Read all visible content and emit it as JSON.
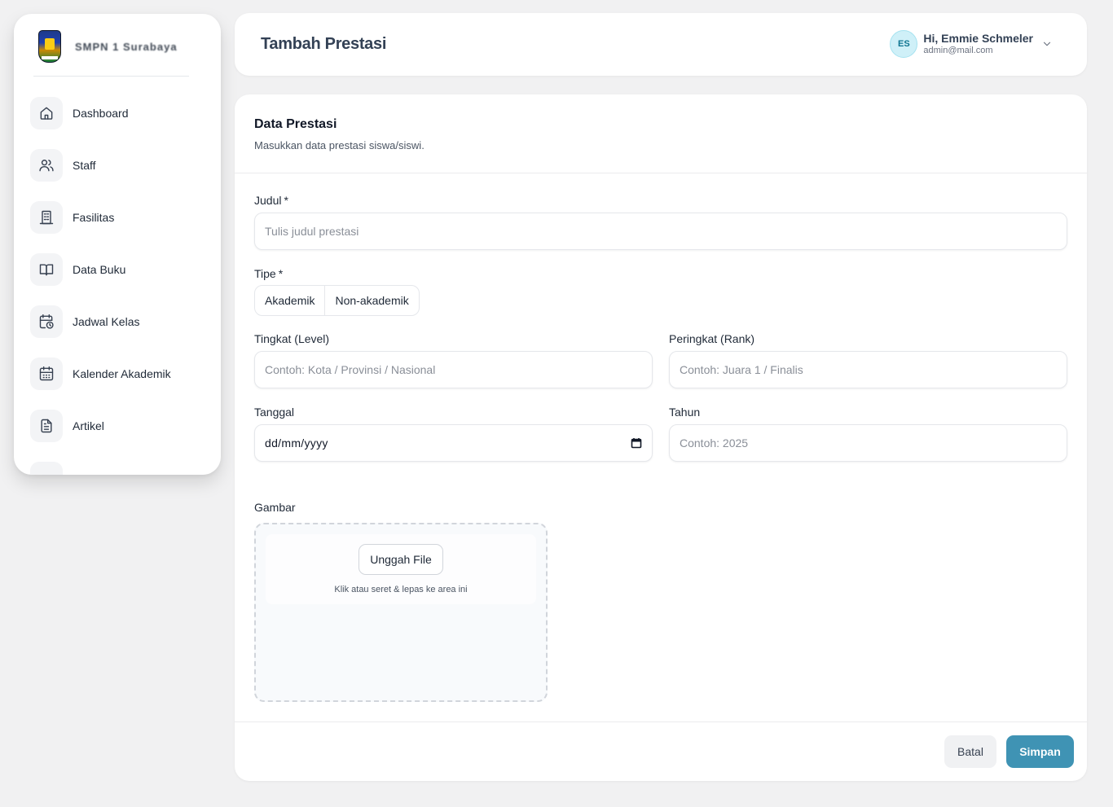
{
  "brand": {
    "name": "SMPN 1 Surabaya",
    "logo_icon": "school-emblem-icon"
  },
  "sidebar": {
    "items": [
      {
        "label": "Dashboard",
        "icon": "home-icon"
      },
      {
        "label": "Staff",
        "icon": "users-icon"
      },
      {
        "label": "Fasilitas",
        "icon": "building-icon"
      },
      {
        "label": "Data Buku",
        "icon": "book-icon"
      },
      {
        "label": "Jadwal Kelas",
        "icon": "calendar-clock-icon"
      },
      {
        "label": "Kalender Akademik",
        "icon": "calendar-icon"
      },
      {
        "label": "Artikel",
        "icon": "document-icon"
      }
    ]
  },
  "header": {
    "title": "Tambah Prestasi",
    "user": {
      "initials": "ES",
      "greeting": "Hi, Emmie Schmeler",
      "email": "admin@mail.com"
    }
  },
  "form": {
    "title": "Data Prestasi",
    "subtitle": "Masukkan data prestasi siswa/siswi.",
    "judul": {
      "label": "Judul",
      "required_mark": "*",
      "placeholder": "Tulis judul prestasi",
      "value": ""
    },
    "tipe": {
      "label": "Tipe",
      "required_mark": "*",
      "options": [
        "Akademik",
        "Non-akademik"
      ]
    },
    "tingkat": {
      "label": "Tingkat (Level)",
      "placeholder": "Contoh: Kota / Provinsi / Nasional"
    },
    "peringkat": {
      "label": "Peringkat (Rank)",
      "placeholder": "Contoh: Juara 1 / Finalis"
    },
    "tanggal": {
      "label": "Tanggal",
      "value_text": "dd/mm/yyyy"
    },
    "tahun": {
      "label": "Tahun",
      "placeholder": "Contoh: 2025"
    },
    "gambar": {
      "label": "Gambar",
      "upload_button": "Unggah File",
      "hint": "Klik atau seret & lepas ke area ini"
    }
  },
  "actions": {
    "cancel": "Batal",
    "save": "Simpan"
  },
  "colors": {
    "primary": "#3f93b4",
    "avatar_bg": "#cff0f8",
    "background": "#f1f1f2"
  }
}
